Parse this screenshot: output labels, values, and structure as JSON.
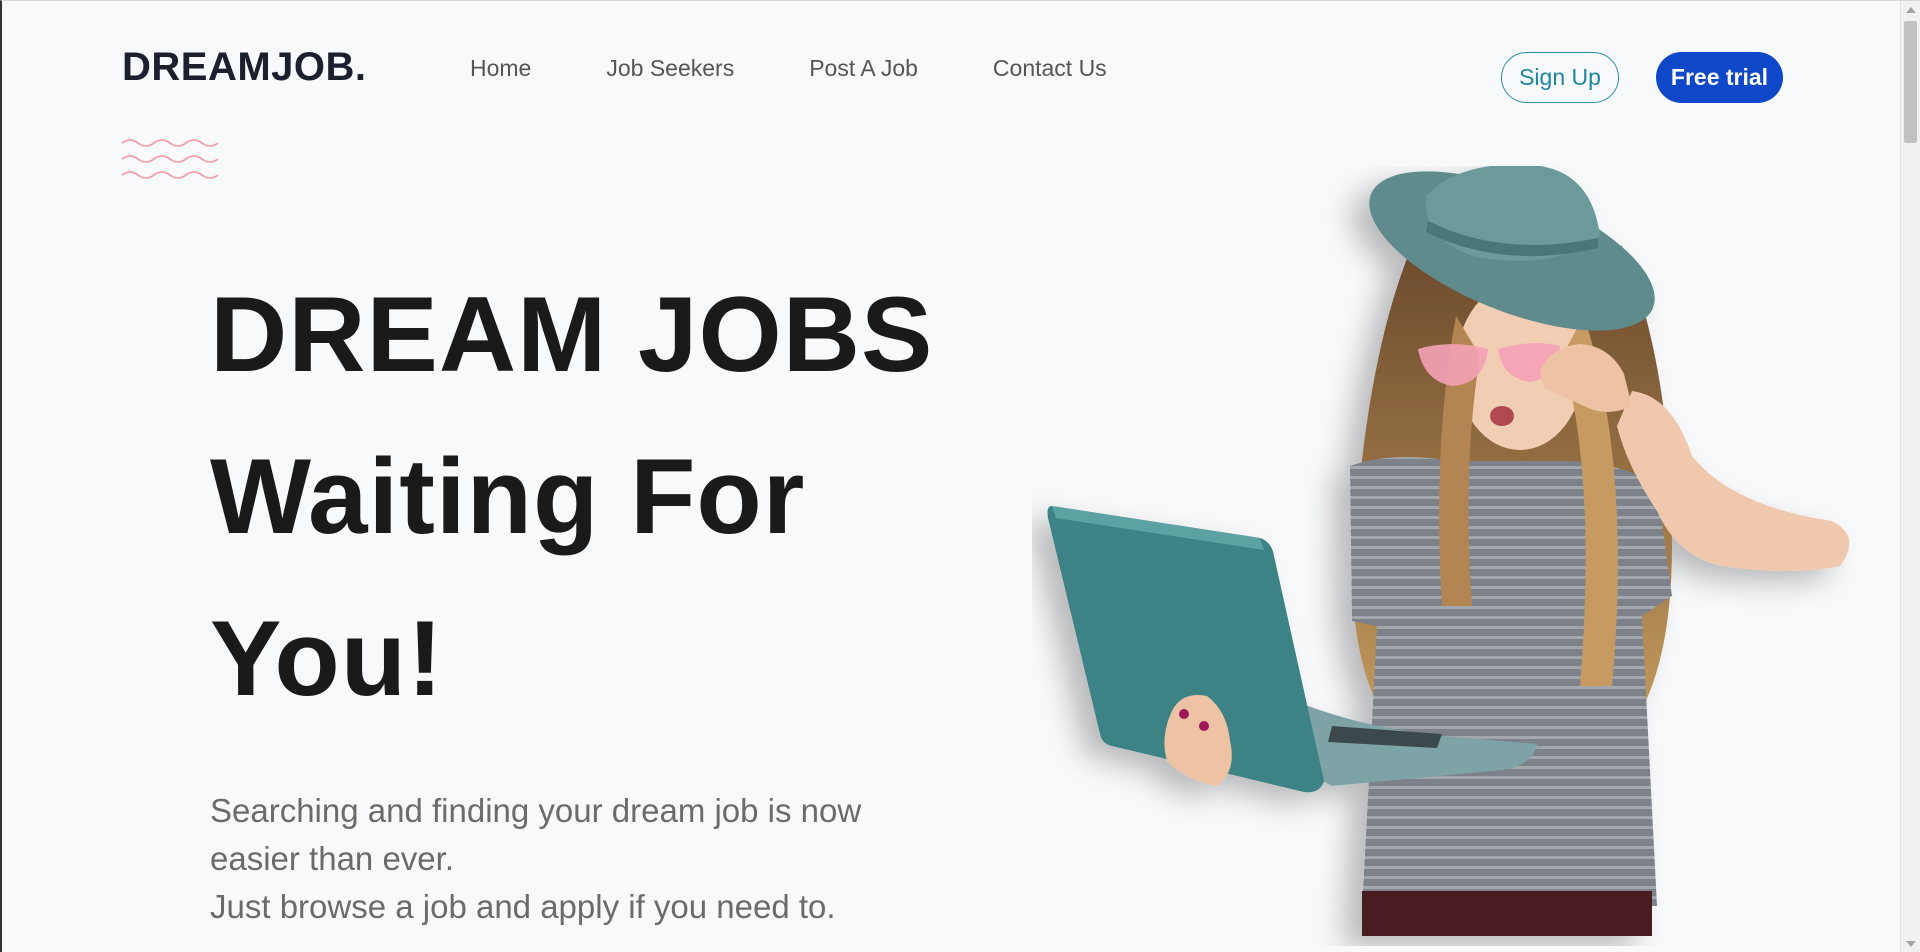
{
  "brand": {
    "logo": "DREAMJOB."
  },
  "nav": {
    "items": [
      {
        "label": "Home"
      },
      {
        "label": "Job Seekers"
      },
      {
        "label": "Post A Job"
      },
      {
        "label": "Contact Us"
      }
    ]
  },
  "header_actions": {
    "signup_label": "Sign Up",
    "trial_label": "Free trial"
  },
  "hero": {
    "title_lines": [
      "DREAM JOBS",
      "Waiting For",
      "You!"
    ],
    "description_lines": [
      "Searching and finding your dream job is now",
      "easier than ever.",
      "Just browse a job and apply if you need to."
    ]
  },
  "colors": {
    "background": "#f8f9fb",
    "primary_button": "#0e47c7",
    "outline_button": "#2c8fa8",
    "wave_decoration": "#f0a6b4"
  },
  "icons": {
    "decoration": "wave-decoration-icon",
    "hero_image": "woman-with-laptop-image"
  }
}
